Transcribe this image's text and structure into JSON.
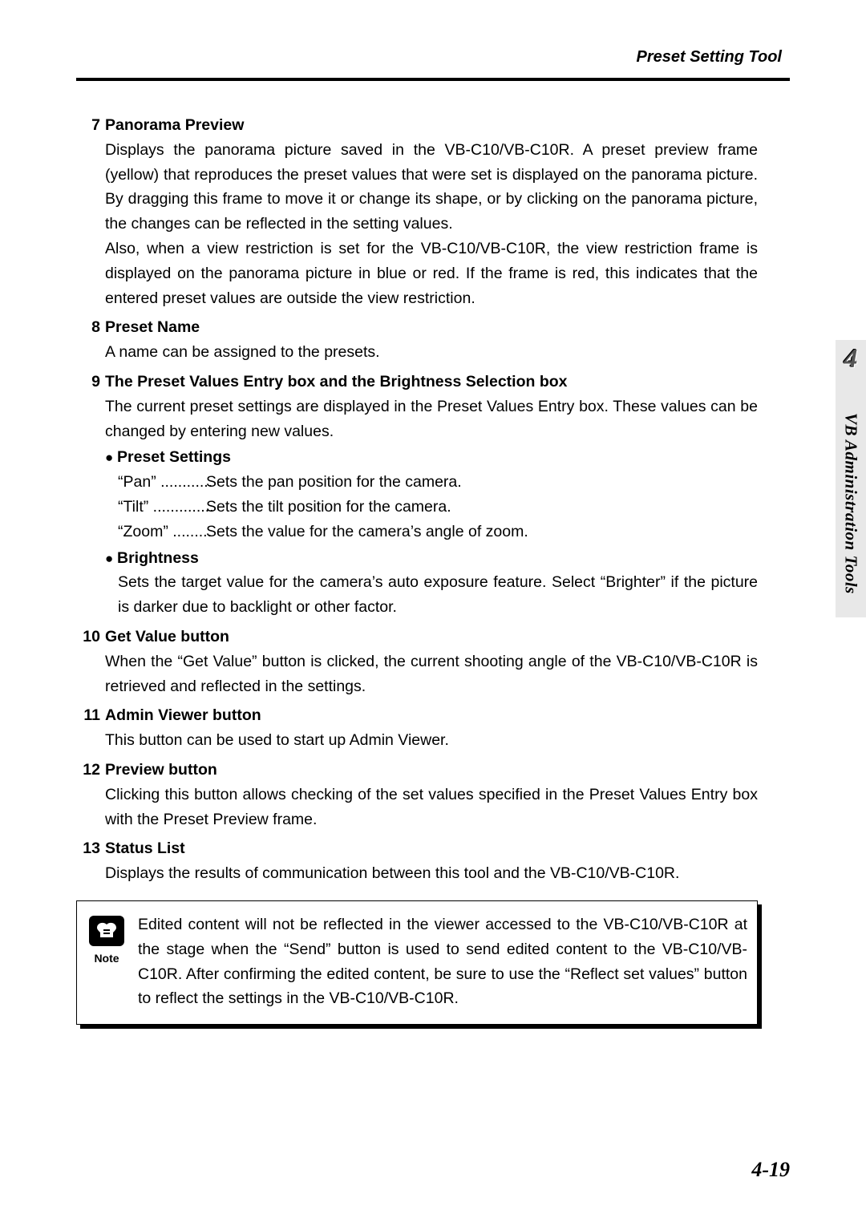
{
  "header": {
    "title": "Preset Setting Tool"
  },
  "side": {
    "chapter": "4",
    "label": "VB Administration Tools"
  },
  "footer": {
    "page": "4-19"
  },
  "items": {
    "s7": {
      "num": "7",
      "title": "Panorama Preview",
      "p1": "Displays the panorama picture saved in the VB-C10/VB-C10R. A preset preview frame (yellow) that reproduces the preset values that were set is displayed on the panorama picture. By dragging this frame to move it or change its shape, or by clicking on the panorama picture, the changes can be reflected in the setting values.",
      "p2": "Also, when a view restriction is set for the VB-C10/VB-C10R, the view restriction frame is displayed on the panorama picture in blue or red. If the frame is red, this indicates that the entered preset values are outside the view restriction."
    },
    "s8": {
      "num": "8",
      "title": "Preset Name",
      "p1": "A name can be assigned to the presets."
    },
    "s9": {
      "num": "9",
      "title": "The Preset Values Entry box and the Brightness Selection box",
      "p1": "The current preset settings are displayed in the Preset Values Entry box. These values can be changed by entering new values.",
      "presetSettingsLabel": "Preset Settings",
      "settings": {
        "pan": {
          "label": "“Pan” ............",
          "desc": "Sets the pan position for the camera."
        },
        "tilt": {
          "label": "“Tilt” ..............",
          "desc": "Sets the tilt position for the camera."
        },
        "zoom": {
          "label": "“Zoom” .........",
          "desc": "Sets the value for the camera’s angle of zoom."
        }
      },
      "brightnessLabel": "Brightness",
      "brightnessBody": "Sets the target value for the camera’s auto exposure feature. Select “Brighter” if the picture is darker due to backlight or other factor."
    },
    "s10": {
      "num": "10",
      "title": "Get Value button",
      "p1": "When the “Get Value” button is clicked, the current shooting angle of the VB-C10/VB-C10R is retrieved and reflected in the settings."
    },
    "s11": {
      "num": "11",
      "title": "Admin Viewer button",
      "p1": "This button can be used to start up Admin Viewer."
    },
    "s12": {
      "num": "12",
      "title": "Preview button",
      "p1": "Clicking this button allows checking of the set values specified in the Preset Values Entry box with the Preset Preview frame."
    },
    "s13": {
      "num": "13",
      "title": "Status List",
      "p1": "Displays the results of communication between this tool and the VB-C10/VB-C10R."
    }
  },
  "note": {
    "label": "Note",
    "text": "Edited content will not be reflected in the viewer accessed to the VB-C10/VB-C10R at the stage when the “Send” button is used to send edited content to the VB-C10/VB-C10R. After confirming the edited content, be sure to use the “Reflect set values” button to reflect the settings in the VB-C10/VB-C10R."
  }
}
